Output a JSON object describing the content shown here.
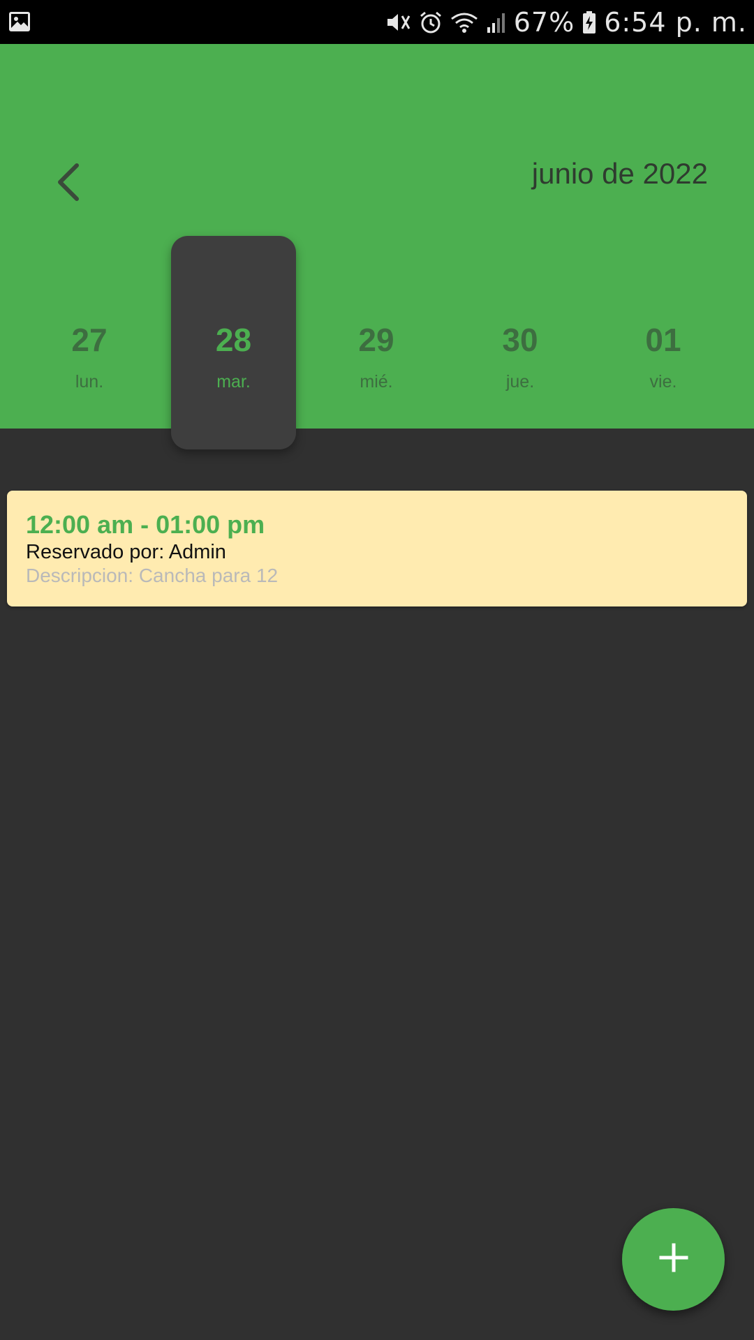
{
  "status_bar": {
    "battery_text": "67%",
    "time_text": "6:54 p. m.",
    "icons": [
      "gallery-icon",
      "mute-icon",
      "alarm-icon",
      "wifi-icon",
      "signal-icon",
      "battery-charging-icon"
    ]
  },
  "header": {
    "month_title": "junio de 2022",
    "back_icon": "chevron-left-icon",
    "days": [
      {
        "num": "27",
        "label": "lun."
      },
      {
        "num": "28",
        "label": "mar."
      },
      {
        "num": "29",
        "label": "mié."
      },
      {
        "num": "30",
        "label": "jue."
      },
      {
        "num": "01",
        "label": "vie."
      }
    ],
    "selected_index": 1
  },
  "events": [
    {
      "time": "12:00 am - 01:00 pm",
      "owner": "Reservado por: Admin",
      "description": "Descripcion: Cancha para 12"
    }
  ],
  "fab": {
    "icon": "plus-icon"
  },
  "colors": {
    "accent": "#4caf50",
    "background": "#303030",
    "card": "#ffebb0",
    "selected_day_bg": "#3e3e3e"
  }
}
